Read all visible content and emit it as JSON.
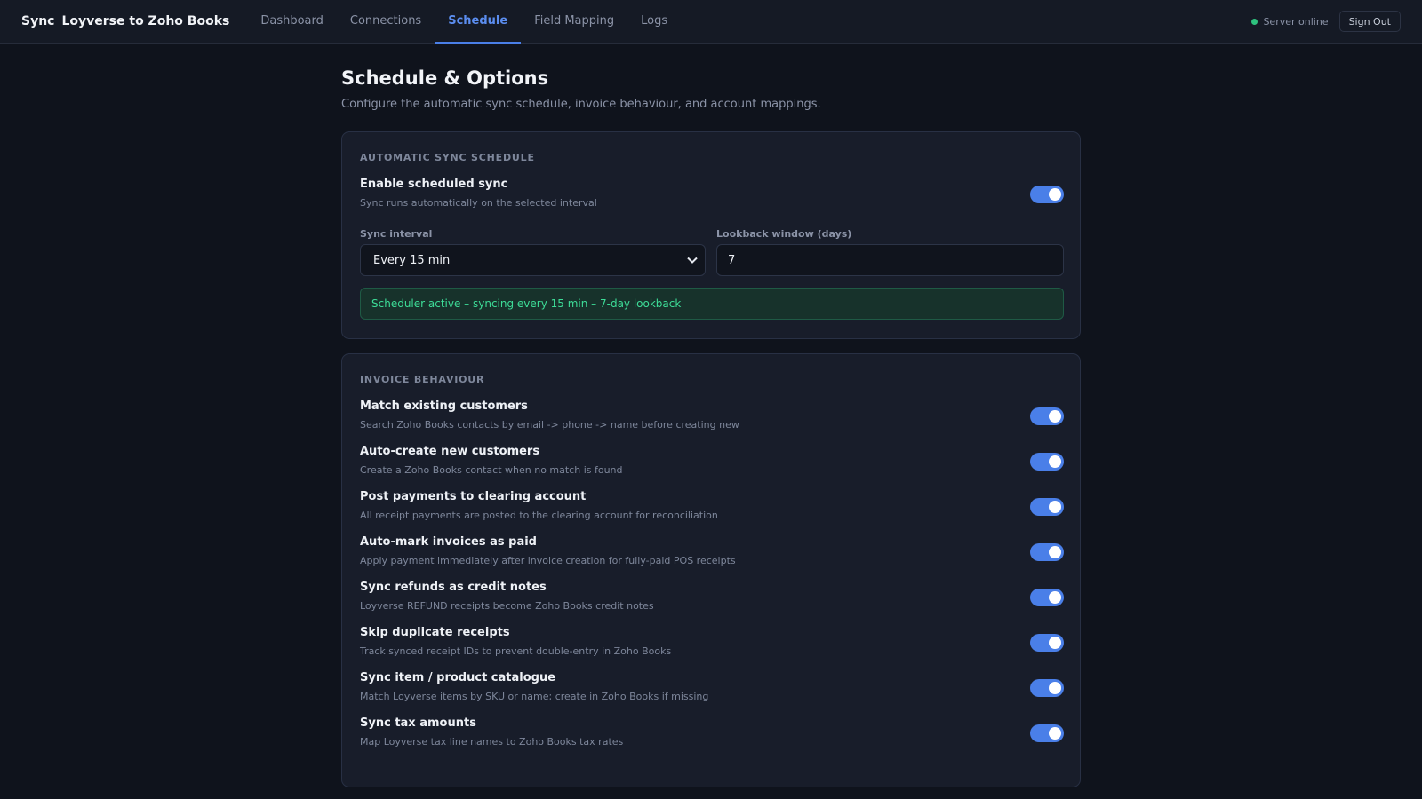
{
  "brand": {
    "prefix": "Sync",
    "name": "Loyverse to Zoho Books"
  },
  "nav": {
    "tabs": [
      {
        "label": "Dashboard"
      },
      {
        "label": "Connections"
      },
      {
        "label": "Schedule"
      },
      {
        "label": "Field Mapping"
      },
      {
        "label": "Logs"
      }
    ],
    "active": "Schedule"
  },
  "header_right": {
    "status": "Server online",
    "status_color": "#2ec27e",
    "signout": "Sign Out"
  },
  "page": {
    "title": "Schedule & Options",
    "subtitle": "Configure the automatic sync schedule, invoice behaviour, and account mappings."
  },
  "schedule": {
    "section": "AUTOMATIC SYNC SCHEDULE",
    "enable": {
      "title": "Enable scheduled sync",
      "desc": "Sync runs automatically on the selected interval",
      "on": true
    },
    "interval_label": "Sync interval",
    "interval_value": "Every 15 min",
    "lookback_label": "Lookback window (days)",
    "lookback_value": "7",
    "banner": "Scheduler active – syncing every 15 min – 7-day lookback"
  },
  "invoice": {
    "section": "INVOICE BEHAVIOUR",
    "items": [
      {
        "title": "Match existing customers",
        "desc": "Search Zoho Books contacts by email -> phone -> name before creating new",
        "on": true
      },
      {
        "title": "Auto-create new customers",
        "desc": "Create a Zoho Books contact when no match is found",
        "on": true
      },
      {
        "title": "Post payments to clearing account",
        "desc": "All receipt payments are posted to the clearing account for reconciliation",
        "on": true
      },
      {
        "title": "Auto-mark invoices as paid",
        "desc": "Apply payment immediately after invoice creation for fully-paid POS receipts",
        "on": true
      },
      {
        "title": "Sync refunds as credit notes",
        "desc": "Loyverse REFUND receipts become Zoho Books credit notes",
        "on": true
      },
      {
        "title": "Skip duplicate receipts",
        "desc": "Track synced receipt IDs to prevent double-entry in Zoho Books",
        "on": true
      },
      {
        "title": "Sync item / product catalogue",
        "desc": "Match Loyverse items by SKU or name; create in Zoho Books if missing",
        "on": true
      },
      {
        "title": "Sync tax amounts",
        "desc": "Map Loyverse tax line names to Zoho Books tax rates",
        "on": true
      }
    ]
  },
  "colors": {
    "accent": "#4a7fe8",
    "success": "#3ddc97",
    "background": "#0f131c",
    "card": "#181d2a"
  }
}
